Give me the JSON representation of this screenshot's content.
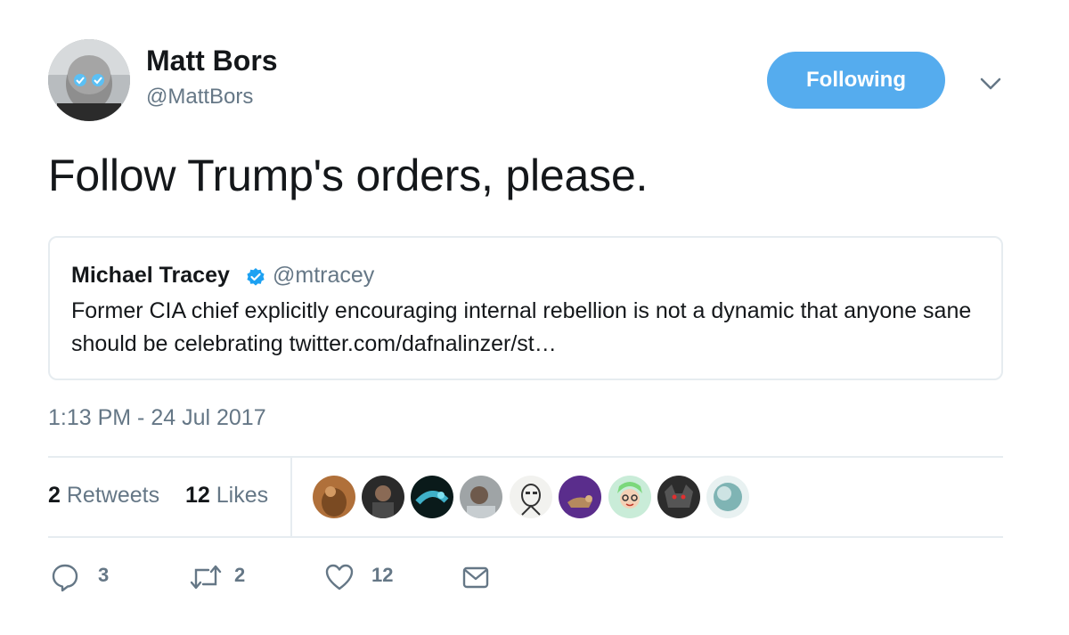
{
  "author": {
    "name": "Matt Bors",
    "handle": "@MattBors",
    "follow_label": "Following"
  },
  "tweet": {
    "text": "Follow Trump's orders, please.",
    "timestamp": "1:13 PM - 24 Jul 2017"
  },
  "quoted": {
    "name": "Michael Tracey",
    "handle": "@mtracey",
    "text": "Former CIA chief explicitly encouraging internal rebellion is not a dynamic that anyone sane should be celebrating twitter.com/dafnalinzer/st…"
  },
  "stats": {
    "retweets_count": "2",
    "retweets_label": "Retweets",
    "likes_count": "12",
    "likes_label": "Likes"
  },
  "actions": {
    "reply_count": "3",
    "retweet_count": "2",
    "like_count": "12"
  },
  "colors": {
    "accent": "#55acee",
    "secondary_text": "#657786",
    "border": "#e6ecf0",
    "verified": "#1da1f2"
  },
  "icons": {
    "reply": "reply-icon",
    "retweet": "retweet-icon",
    "like": "heart-icon",
    "dm": "envelope-icon",
    "more": "chevron-down-icon",
    "verified": "verified-badge-icon"
  }
}
